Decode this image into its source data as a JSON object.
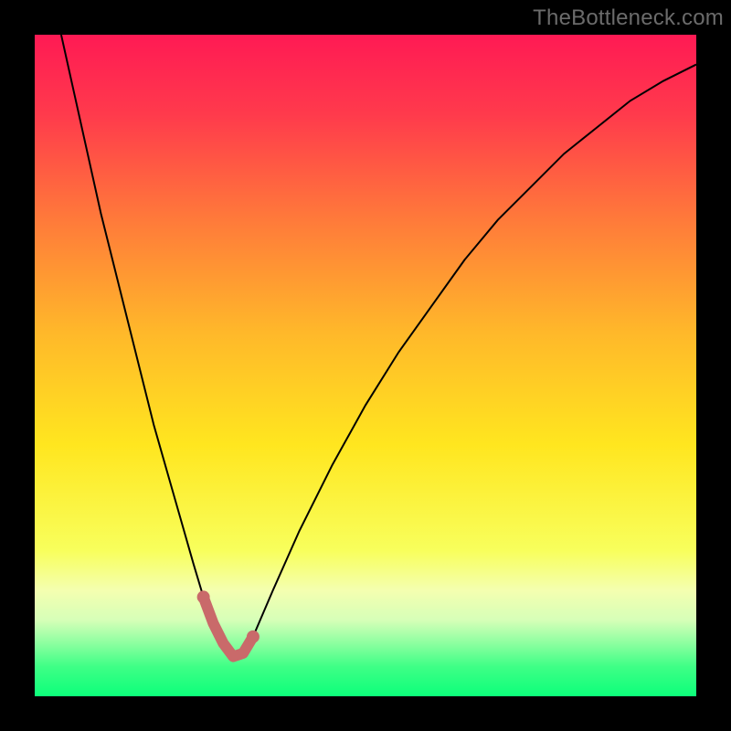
{
  "watermark": "TheBottleneck.com",
  "chart_data": {
    "type": "line",
    "title": "",
    "xlabel": "",
    "ylabel": "",
    "xlim": [
      0,
      100
    ],
    "ylim": [
      0,
      100
    ],
    "grid": false,
    "axes_visible": false,
    "background_gradient_stops": [
      {
        "offset": 0.0,
        "color": "#ff1a54"
      },
      {
        "offset": 0.12,
        "color": "#ff3a4c"
      },
      {
        "offset": 0.28,
        "color": "#ff7a3a"
      },
      {
        "offset": 0.45,
        "color": "#ffb82a"
      },
      {
        "offset": 0.62,
        "color": "#ffe61f"
      },
      {
        "offset": 0.78,
        "color": "#f8ff5c"
      },
      {
        "offset": 0.84,
        "color": "#f4ffb0"
      },
      {
        "offset": 0.885,
        "color": "#d6ffb8"
      },
      {
        "offset": 0.92,
        "color": "#8cffa0"
      },
      {
        "offset": 0.955,
        "color": "#3fff86"
      },
      {
        "offset": 1.0,
        "color": "#0cff7a"
      }
    ],
    "series": [
      {
        "name": "bottleneck-curve",
        "stroke": "#000000",
        "stroke_width": 2,
        "x": [
          4,
          6,
          8,
          10,
          12,
          14,
          16,
          18,
          20,
          22,
          24,
          25.5,
          27,
          28.5,
          30,
          31.5,
          33,
          36,
          40,
          45,
          50,
          55,
          60,
          65,
          70,
          75,
          80,
          85,
          90,
          95,
          100
        ],
        "values": [
          100,
          91,
          82,
          73,
          65,
          57,
          49,
          41,
          34,
          27,
          20,
          15,
          11,
          8,
          6,
          6.5,
          9,
          16,
          25,
          35,
          44,
          52,
          59,
          66,
          72,
          77,
          82,
          86,
          90,
          93,
          95.5
        ]
      },
      {
        "name": "optimal-region-marker",
        "stroke": "#c96a6a",
        "stroke_width": 12,
        "linecap": "round",
        "endpoint_dots": true,
        "x": [
          25.5,
          27,
          28.5,
          30,
          31.5,
          33
        ],
        "values": [
          15,
          11,
          8,
          6,
          6.5,
          9
        ]
      }
    ]
  }
}
